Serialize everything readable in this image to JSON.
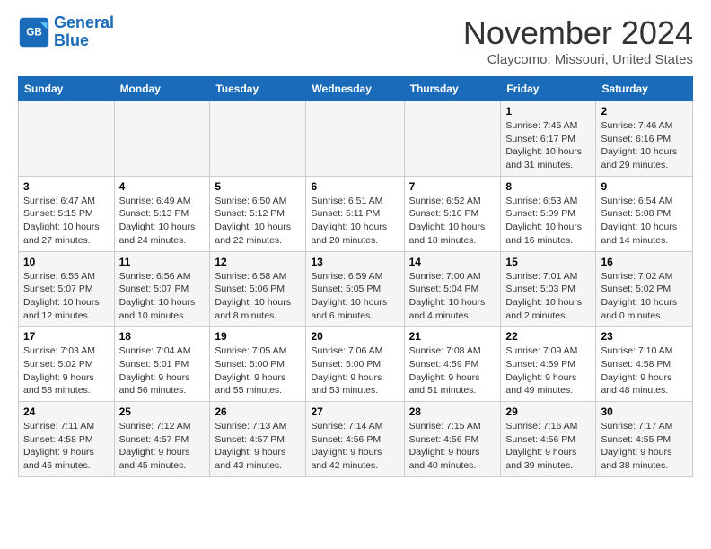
{
  "header": {
    "logo_line1": "General",
    "logo_line2": "Blue",
    "title": "November 2024",
    "subtitle": "Claycomo, Missouri, United States"
  },
  "weekdays": [
    "Sunday",
    "Monday",
    "Tuesday",
    "Wednesday",
    "Thursday",
    "Friday",
    "Saturday"
  ],
  "weeks": [
    [
      {
        "day": "",
        "info": ""
      },
      {
        "day": "",
        "info": ""
      },
      {
        "day": "",
        "info": ""
      },
      {
        "day": "",
        "info": ""
      },
      {
        "day": "",
        "info": ""
      },
      {
        "day": "1",
        "info": "Sunrise: 7:45 AM\nSunset: 6:17 PM\nDaylight: 10 hours\nand 31 minutes."
      },
      {
        "day": "2",
        "info": "Sunrise: 7:46 AM\nSunset: 6:16 PM\nDaylight: 10 hours\nand 29 minutes."
      }
    ],
    [
      {
        "day": "3",
        "info": "Sunrise: 6:47 AM\nSunset: 5:15 PM\nDaylight: 10 hours\nand 27 minutes."
      },
      {
        "day": "4",
        "info": "Sunrise: 6:49 AM\nSunset: 5:13 PM\nDaylight: 10 hours\nand 24 minutes."
      },
      {
        "day": "5",
        "info": "Sunrise: 6:50 AM\nSunset: 5:12 PM\nDaylight: 10 hours\nand 22 minutes."
      },
      {
        "day": "6",
        "info": "Sunrise: 6:51 AM\nSunset: 5:11 PM\nDaylight: 10 hours\nand 20 minutes."
      },
      {
        "day": "7",
        "info": "Sunrise: 6:52 AM\nSunset: 5:10 PM\nDaylight: 10 hours\nand 18 minutes."
      },
      {
        "day": "8",
        "info": "Sunrise: 6:53 AM\nSunset: 5:09 PM\nDaylight: 10 hours\nand 16 minutes."
      },
      {
        "day": "9",
        "info": "Sunrise: 6:54 AM\nSunset: 5:08 PM\nDaylight: 10 hours\nand 14 minutes."
      }
    ],
    [
      {
        "day": "10",
        "info": "Sunrise: 6:55 AM\nSunset: 5:07 PM\nDaylight: 10 hours\nand 12 minutes."
      },
      {
        "day": "11",
        "info": "Sunrise: 6:56 AM\nSunset: 5:07 PM\nDaylight: 10 hours\nand 10 minutes."
      },
      {
        "day": "12",
        "info": "Sunrise: 6:58 AM\nSunset: 5:06 PM\nDaylight: 10 hours\nand 8 minutes."
      },
      {
        "day": "13",
        "info": "Sunrise: 6:59 AM\nSunset: 5:05 PM\nDaylight: 10 hours\nand 6 minutes."
      },
      {
        "day": "14",
        "info": "Sunrise: 7:00 AM\nSunset: 5:04 PM\nDaylight: 10 hours\nand 4 minutes."
      },
      {
        "day": "15",
        "info": "Sunrise: 7:01 AM\nSunset: 5:03 PM\nDaylight: 10 hours\nand 2 minutes."
      },
      {
        "day": "16",
        "info": "Sunrise: 7:02 AM\nSunset: 5:02 PM\nDaylight: 10 hours\nand 0 minutes."
      }
    ],
    [
      {
        "day": "17",
        "info": "Sunrise: 7:03 AM\nSunset: 5:02 PM\nDaylight: 9 hours\nand 58 minutes."
      },
      {
        "day": "18",
        "info": "Sunrise: 7:04 AM\nSunset: 5:01 PM\nDaylight: 9 hours\nand 56 minutes."
      },
      {
        "day": "19",
        "info": "Sunrise: 7:05 AM\nSunset: 5:00 PM\nDaylight: 9 hours\nand 55 minutes."
      },
      {
        "day": "20",
        "info": "Sunrise: 7:06 AM\nSunset: 5:00 PM\nDaylight: 9 hours\nand 53 minutes."
      },
      {
        "day": "21",
        "info": "Sunrise: 7:08 AM\nSunset: 4:59 PM\nDaylight: 9 hours\nand 51 minutes."
      },
      {
        "day": "22",
        "info": "Sunrise: 7:09 AM\nSunset: 4:59 PM\nDaylight: 9 hours\nand 49 minutes."
      },
      {
        "day": "23",
        "info": "Sunrise: 7:10 AM\nSunset: 4:58 PM\nDaylight: 9 hours\nand 48 minutes."
      }
    ],
    [
      {
        "day": "24",
        "info": "Sunrise: 7:11 AM\nSunset: 4:58 PM\nDaylight: 9 hours\nand 46 minutes."
      },
      {
        "day": "25",
        "info": "Sunrise: 7:12 AM\nSunset: 4:57 PM\nDaylight: 9 hours\nand 45 minutes."
      },
      {
        "day": "26",
        "info": "Sunrise: 7:13 AM\nSunset: 4:57 PM\nDaylight: 9 hours\nand 43 minutes."
      },
      {
        "day": "27",
        "info": "Sunrise: 7:14 AM\nSunset: 4:56 PM\nDaylight: 9 hours\nand 42 minutes."
      },
      {
        "day": "28",
        "info": "Sunrise: 7:15 AM\nSunset: 4:56 PM\nDaylight: 9 hours\nand 40 minutes."
      },
      {
        "day": "29",
        "info": "Sunrise: 7:16 AM\nSunset: 4:56 PM\nDaylight: 9 hours\nand 39 minutes."
      },
      {
        "day": "30",
        "info": "Sunrise: 7:17 AM\nSunset: 4:55 PM\nDaylight: 9 hours\nand 38 minutes."
      }
    ]
  ]
}
